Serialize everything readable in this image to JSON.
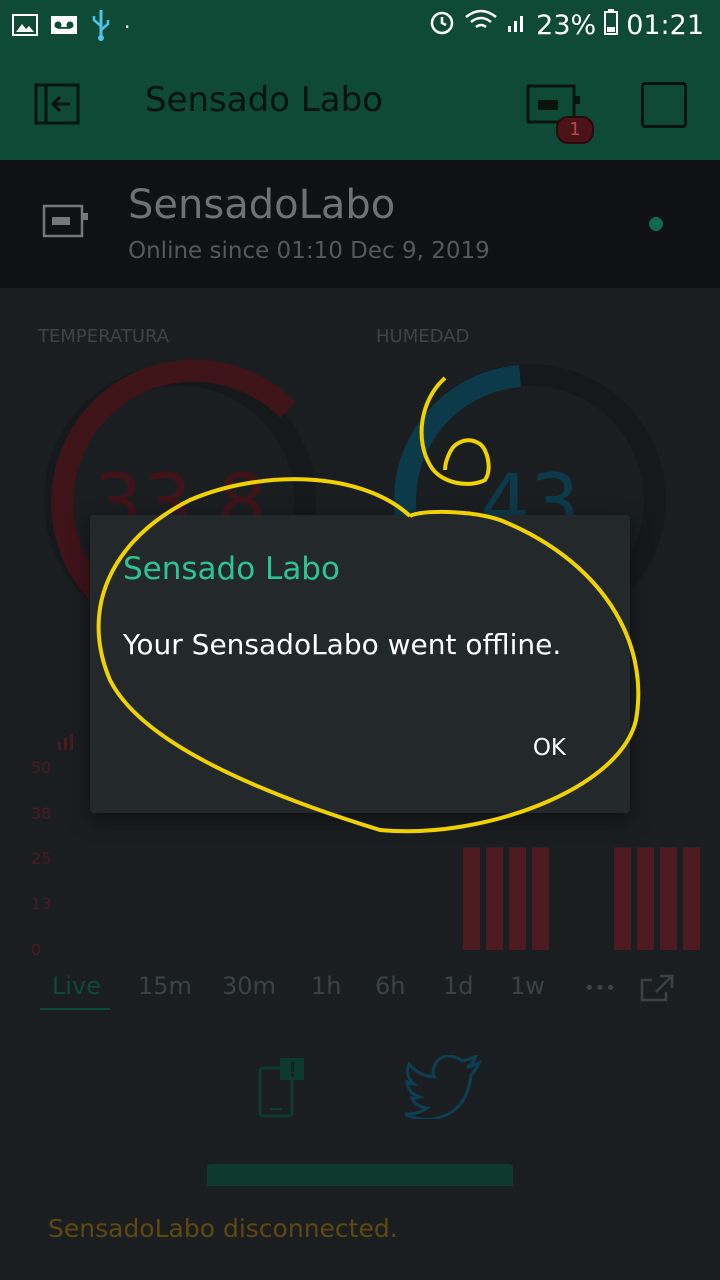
{
  "status_bar": {
    "battery": "23%",
    "time": "01:21",
    "icons": [
      "image-icon",
      "voicemail-icon",
      "usb-icon",
      "alarm-icon",
      "wifi-icon",
      "signal-icon",
      "battery-icon"
    ]
  },
  "app_bar": {
    "title": "Sensado Labo",
    "notification_count": "1"
  },
  "device": {
    "name": "SensadoLabo",
    "online_since": "Online since 01:10 Dec 9, 2019"
  },
  "gauges": {
    "temperature": {
      "label": "TEMPERATURA",
      "value": "33.8"
    },
    "humidity": {
      "label": "HUMEDAD",
      "value": "43"
    }
  },
  "chart": {
    "y_ticks": [
      "50",
      "38",
      "25",
      "13",
      "0"
    ]
  },
  "chart_data": {
    "type": "bar",
    "y_ticks": [
      "50",
      "38",
      "25",
      "13",
      "0"
    ],
    "ylim": [
      0,
      50
    ],
    "values": [
      27,
      27,
      27,
      27,
      27,
      27,
      27,
      27,
      27
    ],
    "colors": {
      "bar": "#4d1a20",
      "axis": "#4a1a1f"
    }
  },
  "time_tabs": [
    "Live",
    "15m",
    "30m",
    "1h",
    "6h",
    "1d",
    "1w"
  ],
  "more_label": "•••",
  "status_message": "SensadoLabo disconnected.",
  "dialog": {
    "title": "Sensado Labo",
    "message": "Your SensadoLabo went offline.",
    "ok_label": "OK"
  },
  "colors": {
    "accent": "#2ec48f",
    "app_bar": "#0f4a37",
    "temperature": "#4d1a20",
    "humidity": "#0d3a4a",
    "annotation": "#ffe000"
  }
}
